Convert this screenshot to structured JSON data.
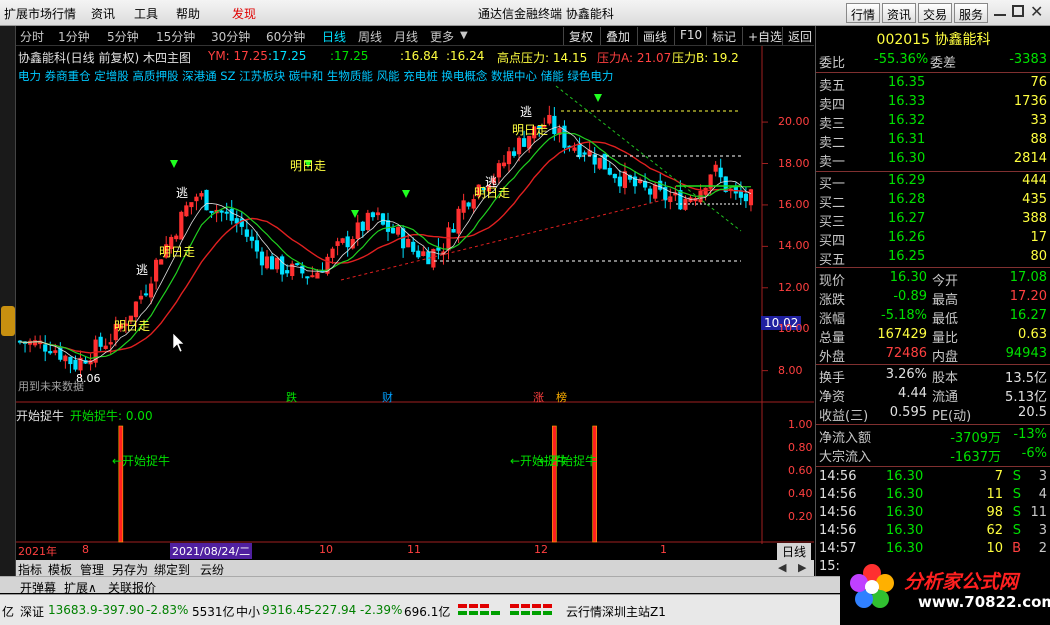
{
  "menu": {
    "items": [
      "扩展市场行情",
      "资讯",
      "工具",
      "帮助"
    ],
    "discover": "发现",
    "window_title": "通达信金融终端   协鑫能科",
    "right_buttons": [
      "行情",
      "资讯",
      "交易",
      "服务"
    ]
  },
  "toolbar": {
    "periods": [
      "分时",
      "1分钟",
      "5分钟",
      "15分钟",
      "30分钟",
      "60分钟",
      "日线",
      "周线",
      "月线",
      "更多"
    ],
    "active": "日线",
    "right": [
      "复权",
      "叠加",
      "画线",
      "F10",
      "标记",
      "+自选",
      "返回"
    ]
  },
  "chart_header": {
    "title": "协鑫能科(日线 前复权) 木四主图",
    "ym_label": "YM: 17.25",
    "values": [
      ":17.25",
      ":17.25",
      ":16.84",
      ":16.24"
    ],
    "high_pressure": "高点压力: 14.15",
    "pressure_a": "压力A: 21.07",
    "pressure_b": "压力B: 19.2",
    "concepts": "电力 券商重仓 定增股 高质押股 深港通 SZ 江苏板块 碳中和 生物质能 风能 充电桩 换电概念 数据中心 储能 绿色电力"
  },
  "annotations": {
    "flee": "逃",
    "tomorrow": "明日走",
    "low_label": "8.06",
    "future_label": "用到未来数据",
    "events": [
      "跌",
      "财",
      "涨",
      "榜"
    ],
    "indicator_title": "开始捉牛",
    "indicator_value": "开始捉牛: 0.00",
    "catch_bull": "←开始捉牛",
    "price_tag": "10.02"
  },
  "chart_data": {
    "type": "candlestick",
    "ylim": [
      7.5,
      21.5
    ],
    "yticks": [
      "20.00",
      "18.00",
      "16.00",
      "14.00",
      "12.00",
      "10.00",
      "8.00"
    ],
    "indicator_ticks": [
      "1.00",
      "0.80",
      "0.60",
      "0.40",
      "0.20"
    ],
    "x_labels": [
      "2021年",
      "8",
      "2021/08/24/二",
      "10",
      "11",
      "12",
      "1"
    ],
    "period_label": "日线",
    "signal_days": [
      20,
      106,
      114
    ]
  },
  "quote": {
    "code_name": "002015 协鑫能科",
    "webi": {
      "label": "委比",
      "value": "-55.36%",
      "label2": "委差",
      "value2": "-3383"
    },
    "sells": [
      {
        "label": "卖五",
        "price": "16.35",
        "vol": "76"
      },
      {
        "label": "卖四",
        "price": "16.33",
        "vol": "1736"
      },
      {
        "label": "卖三",
        "price": "16.32",
        "vol": "33"
      },
      {
        "label": "卖二",
        "price": "16.31",
        "vol": "88"
      },
      {
        "label": "卖一",
        "price": "16.30",
        "vol": "2814"
      }
    ],
    "buys": [
      {
        "label": "买一",
        "price": "16.29",
        "vol": "444"
      },
      {
        "label": "买二",
        "price": "16.28",
        "vol": "435"
      },
      {
        "label": "买三",
        "price": "16.27",
        "vol": "388"
      },
      {
        "label": "买四",
        "price": "16.26",
        "vol": "17"
      },
      {
        "label": "买五",
        "price": "16.25",
        "vol": "80"
      }
    ],
    "stats": [
      {
        "l1": "现价",
        "v1": "16.30",
        "c1": "#00e000",
        "l2": "今开",
        "v2": "17.08",
        "c2": "#00e000"
      },
      {
        "l1": "涨跌",
        "v1": "-0.89",
        "c1": "#00e000",
        "l2": "最高",
        "v2": "17.20",
        "c2": "#ff4040"
      },
      {
        "l1": "涨幅",
        "v1": "-5.18%",
        "c1": "#00e000",
        "l2": "最低",
        "v2": "16.27",
        "c2": "#00e000"
      },
      {
        "l1": "总量",
        "v1": "167429",
        "c1": "#ffff40",
        "l2": "量比",
        "v2": "0.63",
        "c2": "#ffff40"
      },
      {
        "l1": "外盘",
        "v1": "72486",
        "c1": "#ff4040",
        "l2": "内盘",
        "v2": "94943",
        "c2": "#00e000"
      }
    ],
    "stats2": [
      {
        "l1": "换手",
        "v1": "3.26%",
        "l2": "股本",
        "v2": "13.5亿"
      },
      {
        "l1": "净资",
        "v1": "4.44",
        "l2": "流通",
        "v2": "5.13亿"
      },
      {
        "l1": "收益(三)",
        "v1": "0.595",
        "l2": "PE(动)",
        "v2": "20.5"
      }
    ],
    "flow": [
      {
        "label": "净流入额",
        "v1": "-3709万",
        "v2": "-13%"
      },
      {
        "label": "大宗流入",
        "v1": "-1637万",
        "v2": "-6%"
      }
    ],
    "ticks": [
      {
        "time": "14:56",
        "price": "16.30",
        "vol": "7",
        "bs": "S",
        "n": "3"
      },
      {
        "time": "14:56",
        "price": "16.30",
        "vol": "11",
        "bs": "S",
        "n": "4"
      },
      {
        "time": "14:56",
        "price": "16.30",
        "vol": "98",
        "bs": "S",
        "n": "11"
      },
      {
        "time": "14:56",
        "price": "16.30",
        "vol": "62",
        "bs": "S",
        "n": "3"
      },
      {
        "time": "14:57",
        "price": "16.30",
        "vol": "10",
        "bs": "B",
        "n": "2"
      },
      {
        "time": "15:",
        "price": "",
        "vol": "",
        "bs": "",
        "n": ""
      }
    ]
  },
  "bottom_tabs": [
    "指标",
    "模板",
    "管理",
    "另存为",
    "绑定到",
    "云纷"
  ],
  "bottom_tabs2": [
    "开弹幕",
    "扩展∧",
    "关联报价"
  ],
  "statusbar": {
    "left": "亿",
    "sz_label": "深证",
    "sz_value": "13683.9",
    "sz_change": "-397.90",
    "sz_pct": "-2.83%",
    "sz_amount": "5531亿",
    "zx_label": "中小",
    "zx_value": "9316.45",
    "zx_change": "-227.94",
    "zx_pct": "-2.39%",
    "zx_amount": "696.1亿",
    "server": "云行情深圳主站Z1"
  },
  "logo": {
    "text": "分析家公式网",
    "url": "www.70822.com"
  }
}
